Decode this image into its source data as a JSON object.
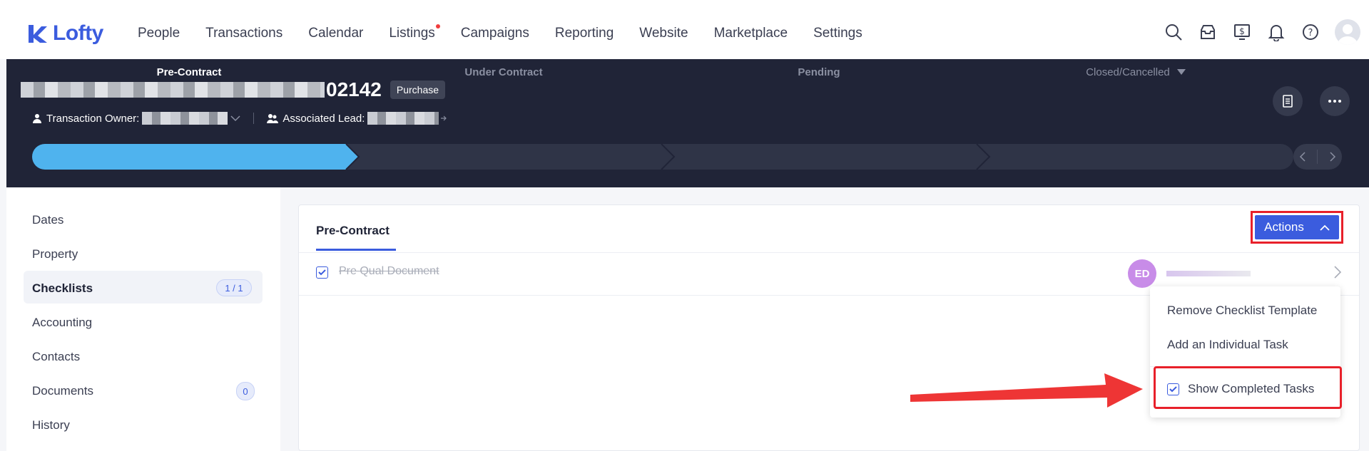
{
  "brand": {
    "name": "Lofty",
    "color": "#3b5cde"
  },
  "nav": {
    "items": [
      "People",
      "Transactions",
      "Calendar",
      "Listings",
      "Campaigns",
      "Reporting",
      "Website",
      "Marketplace",
      "Settings"
    ],
    "icons": [
      "search-icon",
      "inbox-icon",
      "billing-icon",
      "bell-icon",
      "help-icon",
      "avatar"
    ]
  },
  "transaction": {
    "address_suffix": "02142",
    "type_badge": "Purchase",
    "owner_label": "Transaction Owner:",
    "lead_label": "Associated Lead:"
  },
  "pipeline": {
    "stages": [
      "Pre-Contract",
      "Under Contract",
      "Pending",
      "Closed/Cancelled"
    ],
    "active_index": 0,
    "active_color": "#4fb3ee"
  },
  "sidebar": {
    "items": [
      {
        "label": "Dates"
      },
      {
        "label": "Property"
      },
      {
        "label": "Checklists",
        "badge": "1 / 1",
        "active": true
      },
      {
        "label": "Accounting"
      },
      {
        "label": "Contacts"
      },
      {
        "label": "Documents",
        "badge": "0"
      },
      {
        "label": "History"
      }
    ]
  },
  "main": {
    "tab": "Pre-Contract",
    "actions_label": "Actions",
    "task": {
      "name": "Pre Qual Document",
      "assignee_initials": "ED",
      "checked": true
    }
  },
  "dropdown": {
    "items": [
      "Remove Checklist Template",
      "Add an Individual Task",
      "Show Completed Tasks"
    ],
    "show_completed_checked": true
  },
  "annotation_color": "#e8202a"
}
